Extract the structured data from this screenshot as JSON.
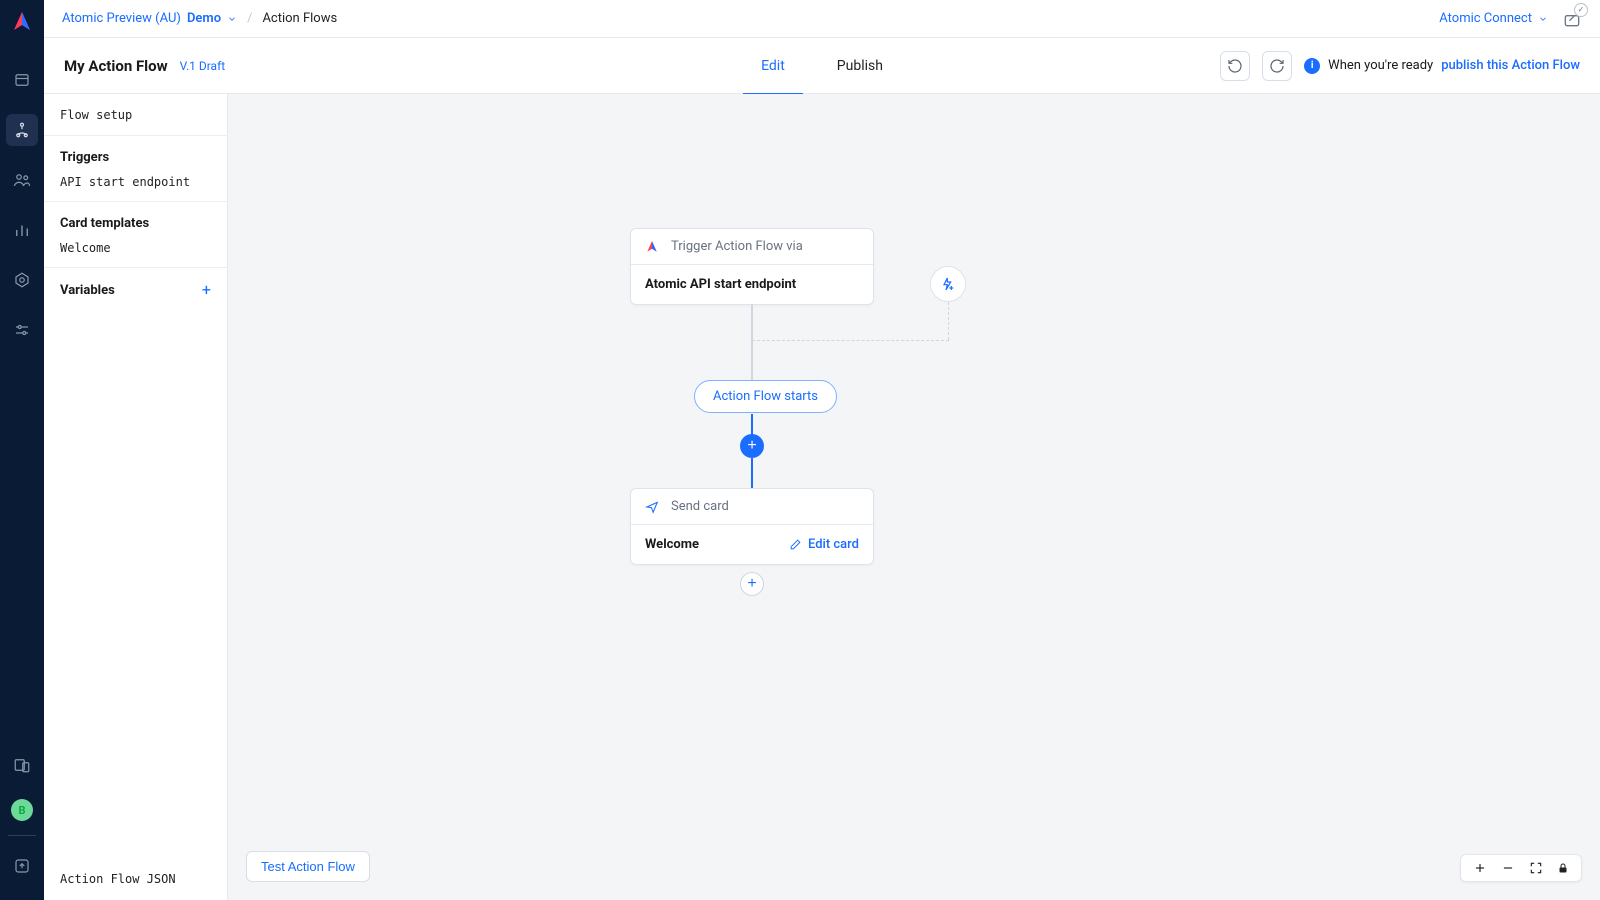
{
  "topbar": {
    "org": "Atomic Preview (AU)",
    "env": "Demo",
    "page": "Action Flows",
    "connect": "Atomic Connect"
  },
  "header": {
    "title": "My Action Flow",
    "version": "V.1 Draft",
    "tabs": {
      "edit": "Edit",
      "publish": "Publish"
    },
    "ready_prefix": "When you're ready",
    "publish_link": "publish this Action Flow"
  },
  "outline": {
    "flow_setup": "Flow setup",
    "triggers_title": "Triggers",
    "triggers_item": "API start endpoint",
    "cards_title": "Card templates",
    "cards_item": "Welcome",
    "variables_title": "Variables",
    "json_link": "Action Flow JSON"
  },
  "canvas": {
    "trigger_head": "Trigger Action Flow via",
    "trigger_body": "Atomic API start endpoint",
    "starts_pill": "Action Flow starts",
    "send_head": "Send card",
    "send_body": "Welcome",
    "edit_card": "Edit card",
    "test_btn": "Test Action Flow"
  },
  "avatar_initial": "B"
}
